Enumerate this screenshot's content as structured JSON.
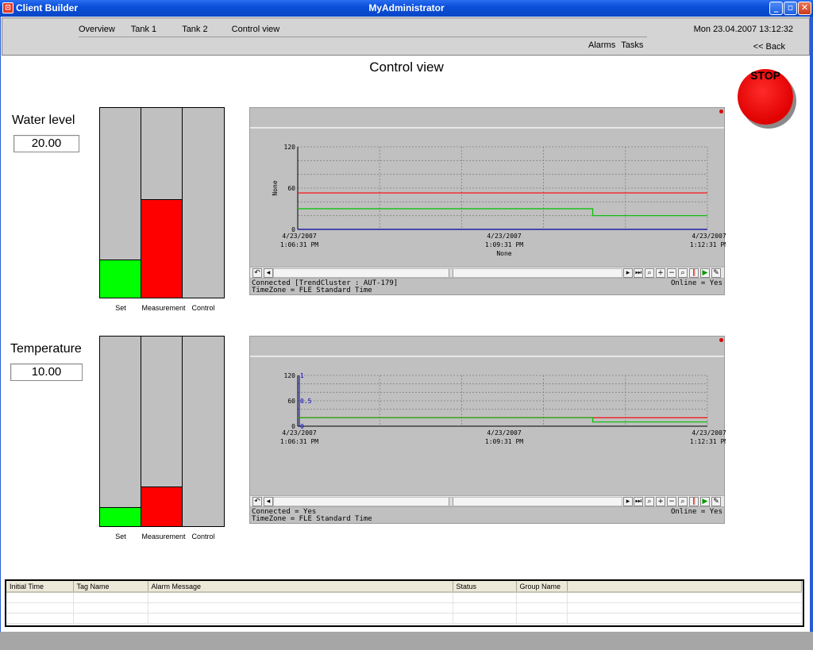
{
  "window": {
    "app_title": "Client Builder",
    "title": "MyAdministrator",
    "minimize": "_",
    "maximize": "▫",
    "close": "✕"
  },
  "nav": {
    "items": [
      "Overview",
      "Tank 1",
      "Tank 2",
      "Control view"
    ],
    "sub_items": [
      "Alarms",
      "Tasks"
    ],
    "datetime": "Mon 23.04.2007 13:12:32",
    "back": "<< Back"
  },
  "page_title": "Control view",
  "stop_label": "STOP",
  "water": {
    "label": "Water level",
    "value": "20.00",
    "bars": {
      "set": 0.2,
      "measurement": 0.52,
      "control": 0.0
    },
    "bar_labels": [
      "Set",
      "Measurement",
      "Control"
    ],
    "trend": {
      "ylabel": "None",
      "xlabel": "None",
      "y_ticks": [
        "120",
        "60",
        "0"
      ],
      "x_ticks": [
        [
          "4/23/2007",
          "1:06:31 PM"
        ],
        [
          "4/23/2007",
          "1:09:31 PM"
        ],
        [
          "4/23/2007",
          "1:12:31 PM"
        ]
      ],
      "status_left_1": "Connected [TrendCluster : AUT-179]",
      "status_left_2": "TimeZone = FLE Standard Time",
      "status_right": "Online = Yes"
    }
  },
  "temperature": {
    "label": "Temperature",
    "value": "10.00",
    "bars": {
      "set": 0.1,
      "measurement": 0.21,
      "control": 0.0
    },
    "bar_labels": [
      "Set",
      "Measurement",
      "Control"
    ],
    "trend": {
      "y_ticks": [
        "120",
        "60",
        "0"
      ],
      "y2_ticks": [
        "1",
        "0.5",
        "0"
      ],
      "x_ticks": [
        [
          "4/23/2007",
          "1:06:31 PM"
        ],
        [
          "4/23/2007",
          "1:09:31 PM"
        ],
        [
          "4/23/2007",
          "1:12:31 PM"
        ]
      ],
      "status_left_1": "Connected = Yes",
      "status_left_2": "TimeZone = FLE Standard Time",
      "status_right": "Online = Yes"
    }
  },
  "chart_data": [
    {
      "type": "line",
      "x": [
        "1:06:31 PM",
        "1:09:31 PM",
        "1:12:31 PM"
      ],
      "ylim": [
        0,
        120
      ],
      "ylabel": "None",
      "xlabel": "None",
      "series": [
        {
          "color": "#ff0000",
          "values": [
            53,
            53,
            53
          ]
        },
        {
          "color": "#00c000",
          "values": [
            30,
            30,
            20
          ]
        },
        {
          "color": "#0000a0",
          "values": [
            0,
            0,
            0
          ]
        }
      ]
    },
    {
      "type": "line",
      "x": [
        "1:06:31 PM",
        "1:09:31 PM",
        "1:12:31 PM"
      ],
      "ylim": [
        0,
        120
      ],
      "series": [
        {
          "color": "#ff0000",
          "values": [
            20,
            20,
            20
          ]
        },
        {
          "color": "#00c000",
          "values": [
            20,
            20,
            10
          ]
        }
      ]
    }
  ],
  "alarm_table": {
    "columns": [
      "Initial Time",
      "Tag Name",
      "Alarm Message",
      "Status",
      "Group Name",
      ""
    ]
  },
  "colors": {
    "set": "#00ff00",
    "measurement": "#ff0000",
    "panel": "#c0c0c0"
  }
}
